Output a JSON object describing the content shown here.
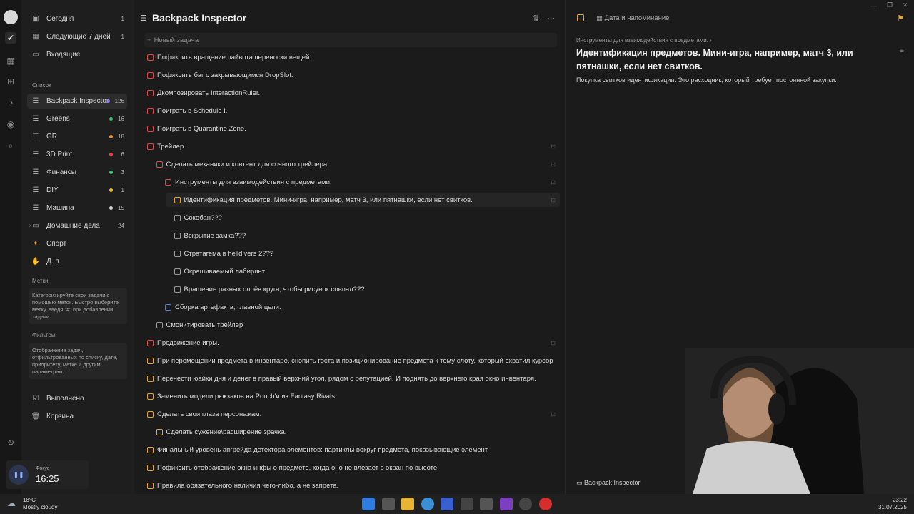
{
  "sidebar": {
    "smart": [
      {
        "label": "Сегодня",
        "count": "1"
      },
      {
        "label": "Следующие 7 дней",
        "count": "1"
      },
      {
        "label": "Входящие",
        "count": ""
      }
    ],
    "list_header": "Список",
    "lists": [
      {
        "label": "Backpack Inspector",
        "count": "126",
        "color": "#8a7cff"
      },
      {
        "label": "Greens",
        "count": "16",
        "color": "#3cc46a"
      },
      {
        "label": "GR",
        "count": "18",
        "color": "#f08a24"
      },
      {
        "label": "3D Print",
        "count": "6",
        "color": "#e04848"
      },
      {
        "label": "Финансы",
        "count": "3",
        "color": "#3cc46a"
      },
      {
        "label": "DIY",
        "count": "1",
        "color": "#e6c229"
      },
      {
        "label": "Машина",
        "count": "15",
        "color": "#d8d8d8"
      },
      {
        "label": "Домашние дела",
        "count": "24",
        "color": ""
      },
      {
        "label": "Спорт",
        "count": "",
        "color": ""
      },
      {
        "label": "Д. п.",
        "count": "",
        "color": ""
      }
    ],
    "tags_header": "Метки",
    "tags_hint": "Категоризируйте свои задачи с помощью меток. Быстро выберите метку, введя \"#\" при добавлении задачи.",
    "filters_header": "Фильтры",
    "filters_hint": "Отображение задач, отфильтрованных по списку, дате, приоритету, метке и другим параметрам.",
    "done": "Выполнено",
    "trash": "Корзина",
    "focus_label": "Фокус",
    "focus_time": "16:25"
  },
  "main": {
    "title": "Backpack Inspector",
    "new_task": "Новый задача",
    "tasks": [
      {
        "text": "Пофиксить вращение пайвота переноски вещей.",
        "indent": 0,
        "color": "#e04848"
      },
      {
        "text": "Пофиксить баг с закрывающимся DropSlot.",
        "indent": 0,
        "color": "#e04848"
      },
      {
        "text": "Дкомпозировать InteractionRuler.",
        "indent": 0,
        "color": "#e04848"
      },
      {
        "text": "Поиграть в Schedule I.",
        "indent": 0,
        "color": "#e04848"
      },
      {
        "text": "Поиграть в Quarantine Zone.",
        "indent": 0,
        "color": "#e04848"
      },
      {
        "text": "Трейлер.",
        "indent": 0,
        "color": "#e04848",
        "chev": true
      },
      {
        "text": "Сделать механики и контент для сочного трейлера",
        "indent": 1,
        "color": "#e04848",
        "chev": true
      },
      {
        "text": "Инструменты для взаимодействия с предметами.",
        "indent": 2,
        "color": "#e04848",
        "chev": true
      },
      {
        "text": "Идентификация предметов. Мини-игра, например, матч 3, или пятнашки, если нет свитков.",
        "indent": 3,
        "color": "#e0a537",
        "hl": true
      },
      {
        "text": "Сокобан???",
        "indent": 3,
        "color": "#999"
      },
      {
        "text": "Вскрытие замка???",
        "indent": 3,
        "color": "#999"
      },
      {
        "text": "Стратагема в helldivers 2???",
        "indent": 3,
        "color": "#999"
      },
      {
        "text": "Окрашиваемый лабиринт.",
        "indent": 3,
        "color": "#999"
      },
      {
        "text": "Вращение разных слоёв круга, чтобы рисунок совпал???",
        "indent": 3,
        "color": "#999"
      },
      {
        "text": "Сборка артефакта, главной цели.",
        "indent": 2,
        "color": "#4a7cff"
      },
      {
        "text": "Смонитировать трейлер",
        "indent": 1,
        "color": "#999"
      },
      {
        "text": "Продвижение игры.",
        "indent": 0,
        "color": "#e04848",
        "chev": true
      },
      {
        "text": "При перемещении предмета в инвентаре, снэпить госта и позиционирование предмета к тому слоту, который схватил курсор",
        "indent": 0,
        "color": "#e0a537"
      },
      {
        "text": "Перенести юайки дня и денег в правый верхний угол, рядом с репутацией. И поднять до верхнего края окно инвентаря.",
        "indent": 0,
        "color": "#e0a537"
      },
      {
        "text": "Заменить модели рюкзаков на Pouch'и из Fantasy Rivals.",
        "indent": 0,
        "color": "#e0a537"
      },
      {
        "text": "Сделать свои глаза персонажам.",
        "indent": 0,
        "color": "#e0a537",
        "chev": true
      },
      {
        "text": "Сделать сужение\\расширение зрачка.",
        "indent": 1,
        "color": "#e0a537"
      },
      {
        "text": "Финальный уровень апгрейда детектора элементов: партиклы вокруг предмета, показывающие элемент.",
        "indent": 0,
        "color": "#e0a537"
      },
      {
        "text": "Пофиксить отображение окна инфы о предмете, когда оно не влезает в экран по высоте.",
        "indent": 0,
        "color": "#e0a537"
      },
      {
        "text": "Правила обязательного наличия чего-либо, а не запрета.",
        "indent": 0,
        "color": "#e0a537"
      }
    ]
  },
  "detail": {
    "date_label": "Дата и напоминание",
    "breadcrumb": "Инструменты для взаимодействия с предметами.",
    "title": "Идентификация предметов. Мини-игра, например, матч 3, или пятнашки, если нет свитков.",
    "body": "Покупка свитков идентификации. Это расходник, который требует постоянной закупки.",
    "footer_list": "Backpack Inspector"
  },
  "taskbar": {
    "temperature": "18°C",
    "weather": "Mostly cloudy",
    "time": "23:22",
    "date": "31.07.2025"
  }
}
